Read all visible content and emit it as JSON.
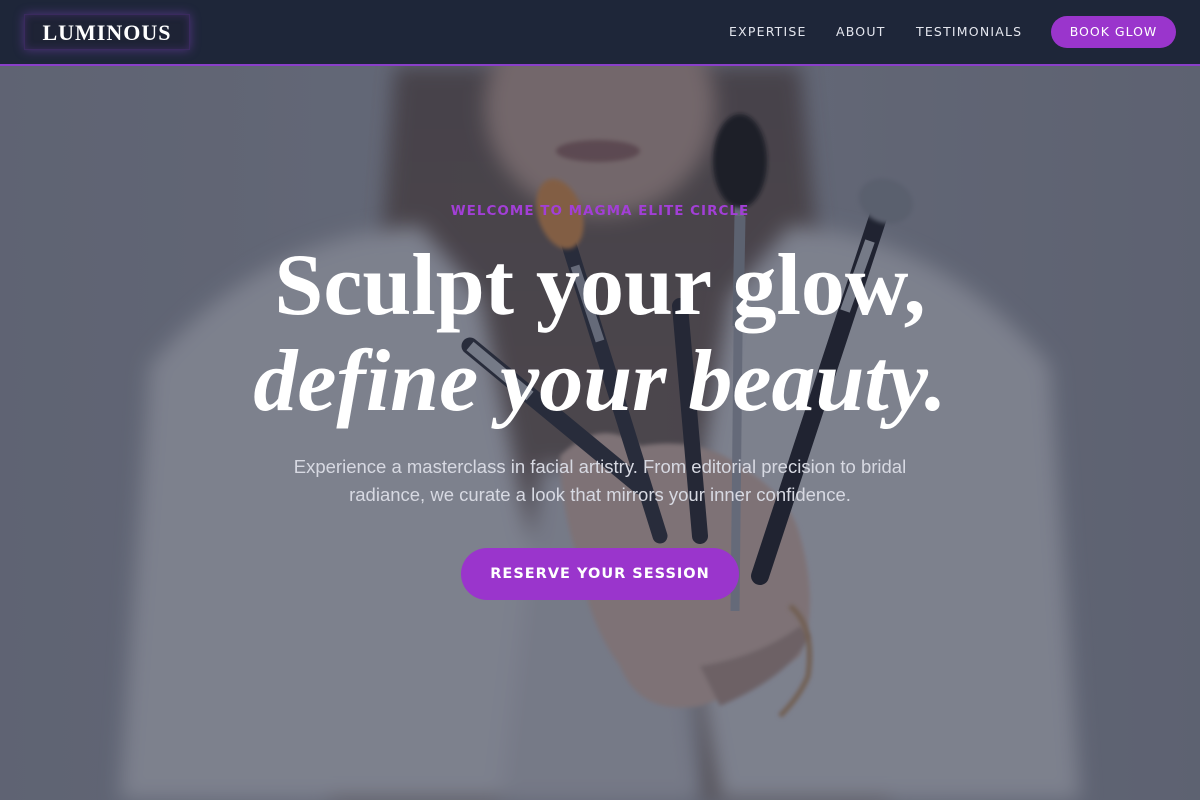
{
  "nav": {
    "logo": "LUMINOUS",
    "links": [
      {
        "label": "EXPERTISE"
      },
      {
        "label": "ABOUT"
      },
      {
        "label": "TESTIMONIALS"
      }
    ],
    "book_label": "BOOK GLOW"
  },
  "hero": {
    "eyebrow": "WELCOME TO MAGMA ELITE CIRCLE",
    "headline_line1": "Sculpt your glow,",
    "headline_line2": "define your beauty.",
    "subtext": "Experience a masterclass in facial artistry. From editorial precision to bridal radiance, we curate a look that mirrors your inner confidence.",
    "cta_label": "RESERVE YOUR SESSION"
  },
  "colors": {
    "nav_bg": "#1e2639",
    "accent": "#9a35cc",
    "eyebrow": "#a23fd6"
  }
}
